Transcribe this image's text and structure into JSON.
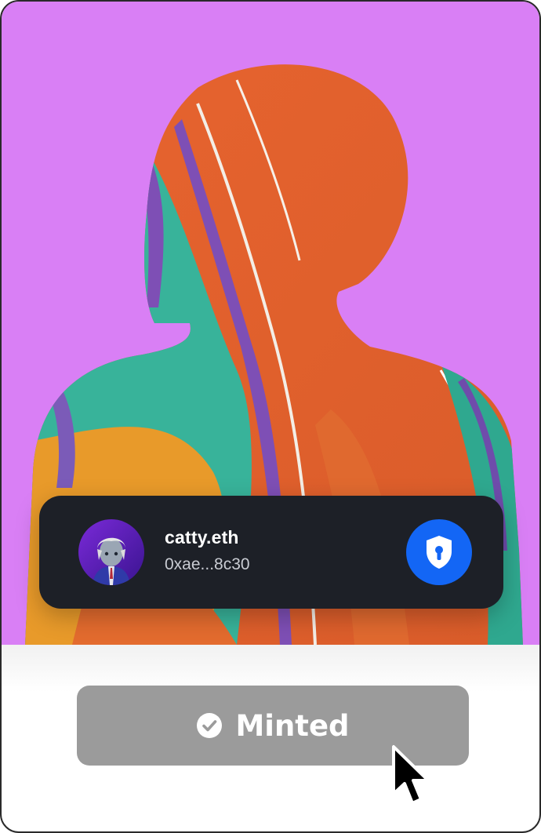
{
  "wallet": {
    "name": "catty.eth",
    "address": "0xae...8c30"
  },
  "mint_button": {
    "label": "Minted",
    "state": "disabled"
  },
  "colors": {
    "background": "#d97ff5",
    "card": "#1d2027",
    "shield": "#1366f5",
    "button": "#9b9b9b"
  },
  "icons": {
    "check": "check-circle-icon",
    "shield": "shield-keyhole-icon",
    "cursor": "mouse-pointer-icon"
  }
}
